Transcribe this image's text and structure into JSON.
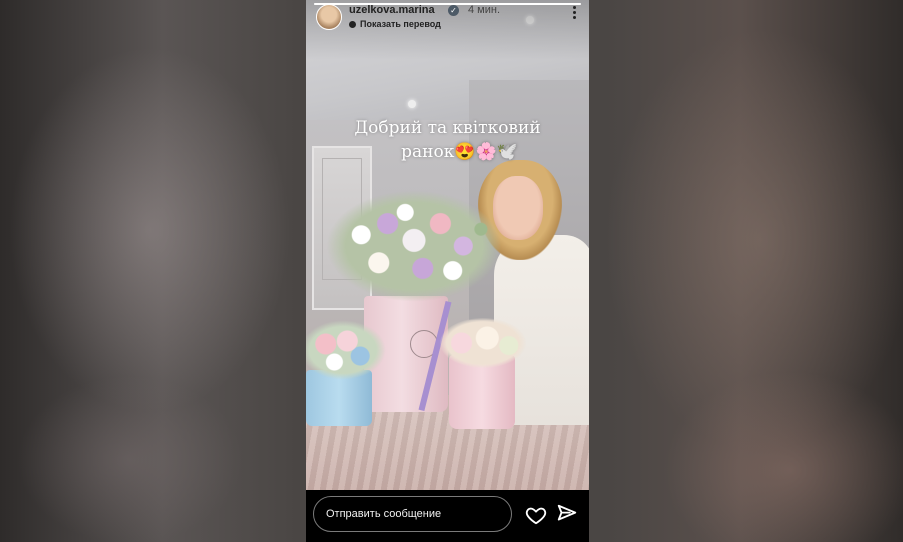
{
  "story": {
    "progress": 1.0,
    "header": {
      "username": "uzelkova.marina",
      "verified_icon": "verified-badge-icon",
      "time": "4 мин.",
      "translate_label": "Показать перевод"
    },
    "caption": {
      "line1": "Добрий та квітковий",
      "line2": "ранок😍🌸🕊️"
    },
    "footer": {
      "message_placeholder": "Отправить сообщение",
      "like_icon": "heart-icon",
      "send_icon": "send-icon"
    }
  }
}
